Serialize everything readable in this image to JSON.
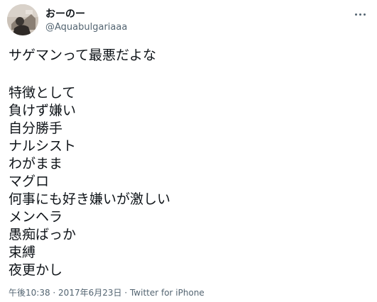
{
  "author": {
    "display_name": "おーのー",
    "handle": "@Aquabulgariaaa",
    "avatar_icon": "user-avatar-photo"
  },
  "menu": {
    "more_icon": "more-horizontal-icon"
  },
  "tweet": {
    "first_line": "サゲマンって最悪だよな",
    "list_lines": [
      "特徴として",
      "負けず嫌い",
      "自分勝手",
      "ナルシスト",
      "わがまま",
      "マグロ",
      "何事にも好き嫌いが激しい",
      "メンヘラ",
      "愚痴ばっか",
      "束縛",
      "夜更かし"
    ]
  },
  "meta": {
    "time": "午後10:38",
    "sep1": " · ",
    "date": "2017年6月23日",
    "sep2": " · ",
    "source": "Twitter for iPhone"
  },
  "colors": {
    "text": "#0f1419",
    "secondary": "#536471",
    "background": "#ffffff"
  }
}
